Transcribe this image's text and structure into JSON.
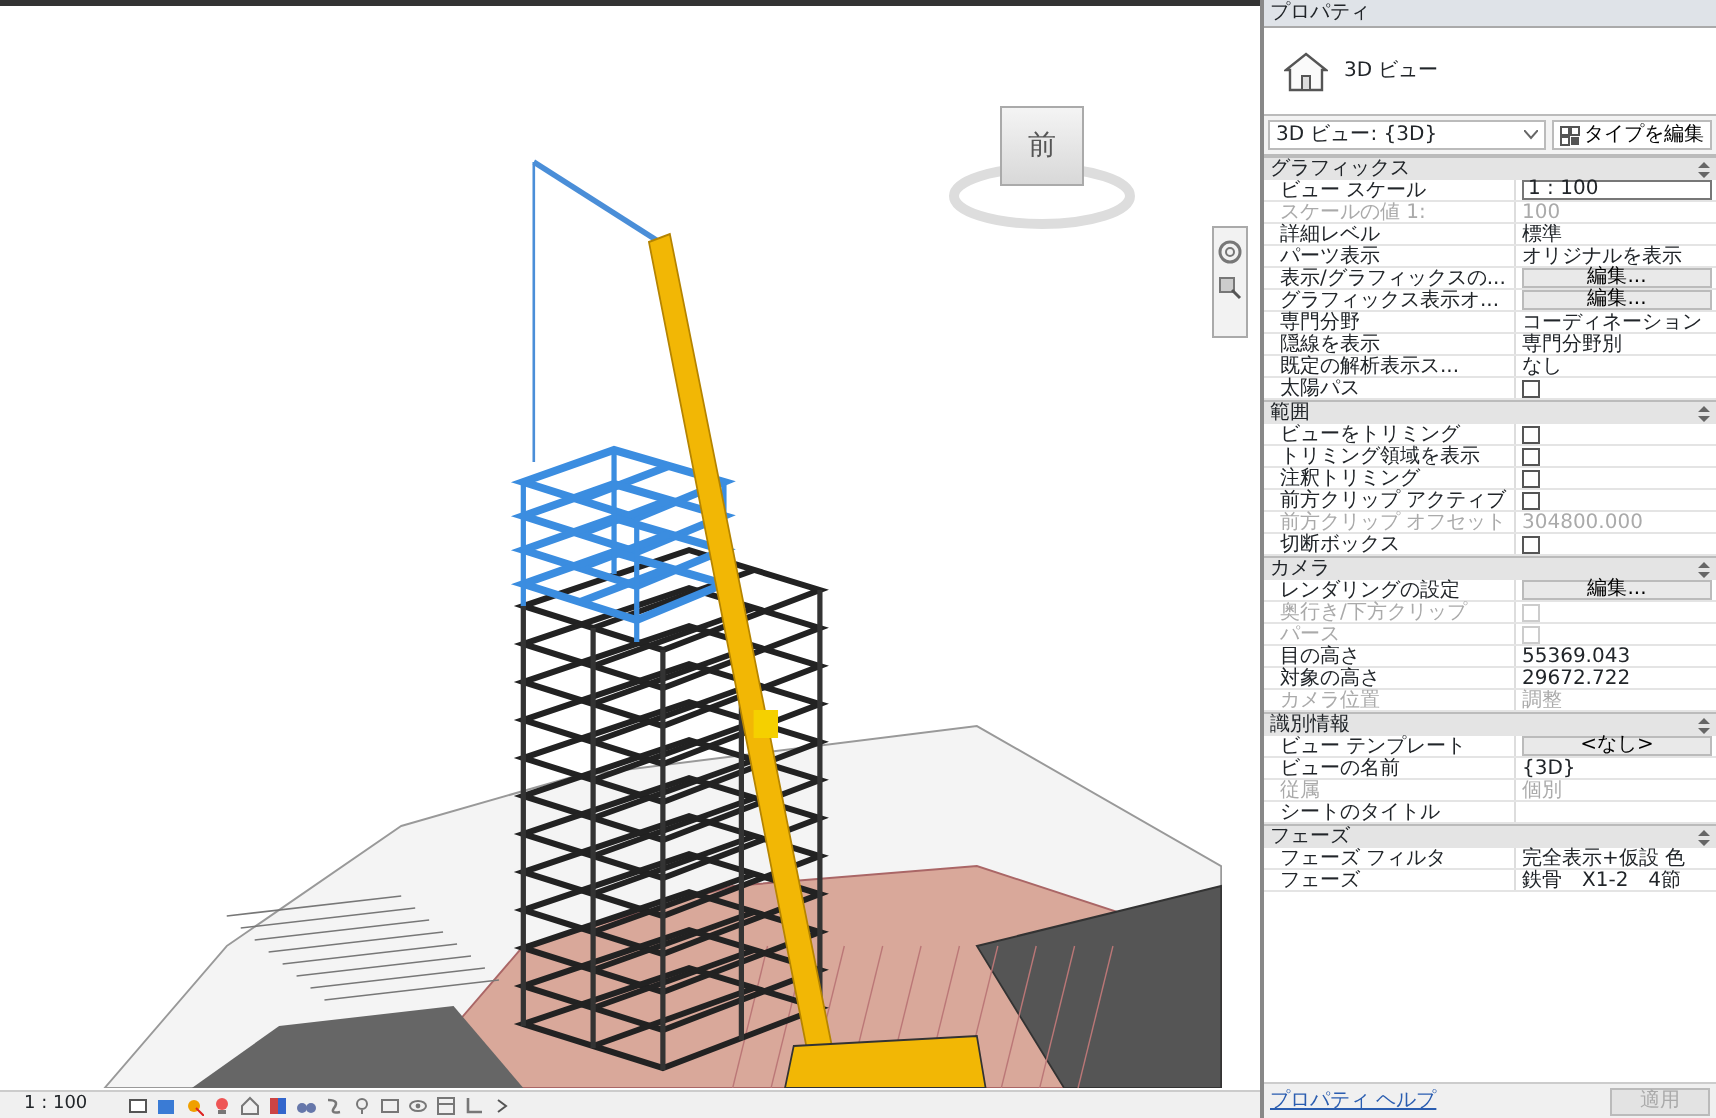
{
  "view": {
    "cube_label": "前",
    "scale": "1 : 100"
  },
  "panel": {
    "title": "プロパティ",
    "type_name": "3D ビュー",
    "selector": "3D ビュー: {3D}",
    "edit_type": "タイプを編集",
    "sections": [
      {
        "title": "グラフィックス",
        "expanded": true,
        "rows": [
          {
            "label": "ビュー スケール",
            "kind": "input",
            "value": "1 : 100",
            "disabled": false
          },
          {
            "label": "スケールの値  1:",
            "kind": "text",
            "value": "100",
            "disabled": true
          },
          {
            "label": "詳細レベル",
            "kind": "text",
            "value": "標準",
            "disabled": false
          },
          {
            "label": "パーツ表示",
            "kind": "text",
            "value": "オリジナルを表示",
            "disabled": false
          },
          {
            "label": "表示/グラフィックスの...",
            "kind": "button",
            "value": "編集...",
            "disabled": false
          },
          {
            "label": "グラフィックス表示オ...",
            "kind": "button",
            "value": "編集...",
            "disabled": false
          },
          {
            "label": "専門分野",
            "kind": "text",
            "value": "コーディネーション",
            "disabled": false
          },
          {
            "label": "隠線を表示",
            "kind": "text",
            "value": "専門分野別",
            "disabled": false
          },
          {
            "label": "既定の解析表示ス...",
            "kind": "text",
            "value": "なし",
            "disabled": false
          },
          {
            "label": "太陽パス",
            "kind": "checkbox",
            "checked": false,
            "disabled": false
          }
        ]
      },
      {
        "title": "範囲",
        "expanded": true,
        "rows": [
          {
            "label": "ビューをトリミング",
            "kind": "checkbox",
            "checked": false,
            "disabled": false
          },
          {
            "label": "トリミング領域を表示",
            "kind": "checkbox",
            "checked": false,
            "disabled": false
          },
          {
            "label": "注釈トリミング",
            "kind": "checkbox",
            "checked": false,
            "disabled": false
          },
          {
            "label": "前方クリップ アクティブ",
            "kind": "checkbox",
            "checked": false,
            "disabled": false
          },
          {
            "label": "前方クリップ オフセット",
            "kind": "text",
            "value": "304800.000",
            "disabled": true
          },
          {
            "label": "切断ボックス",
            "kind": "checkbox",
            "checked": false,
            "disabled": false
          }
        ]
      },
      {
        "title": "カメラ",
        "expanded": true,
        "rows": [
          {
            "label": "レンダリングの設定",
            "kind": "button",
            "value": "編集...",
            "disabled": false
          },
          {
            "label": "奥行き/下方クリップ",
            "kind": "checkbox",
            "checked": false,
            "disabled": true
          },
          {
            "label": "パース",
            "kind": "checkbox",
            "checked": false,
            "disabled": true
          },
          {
            "label": "目の高さ",
            "kind": "text",
            "value": "55369.043",
            "disabled": false
          },
          {
            "label": "対象の高さ",
            "kind": "text",
            "value": "29672.722",
            "disabled": false
          },
          {
            "label": "カメラ位置",
            "kind": "text",
            "value": "調整",
            "disabled": true
          }
        ]
      },
      {
        "title": "識別情報",
        "expanded": true,
        "rows": [
          {
            "label": "ビュー テンプレート",
            "kind": "button",
            "value": "<なし>",
            "disabled": false
          },
          {
            "label": "ビューの名前",
            "kind": "text",
            "value": "{3D}",
            "disabled": false
          },
          {
            "label": "従属",
            "kind": "text",
            "value": "個別",
            "disabled": true
          },
          {
            "label": "シートのタイトル",
            "kind": "text",
            "disabled": false
          }
        ]
      },
      {
        "title": "フェーズ",
        "expanded": true,
        "rows": [
          {
            "label": "フェーズ フィルタ",
            "kind": "text",
            "value": "完全表示+仮設 色",
            "disabled": false
          },
          {
            "label": "フェーズ",
            "kind": "text",
            "value": "鉄骨　X1-2　4節",
            "disabled": false
          }
        ]
      }
    ],
    "help_link": "プロパティ ヘルプ",
    "apply": {
      "label": "適用",
      "disabled": true
    }
  }
}
